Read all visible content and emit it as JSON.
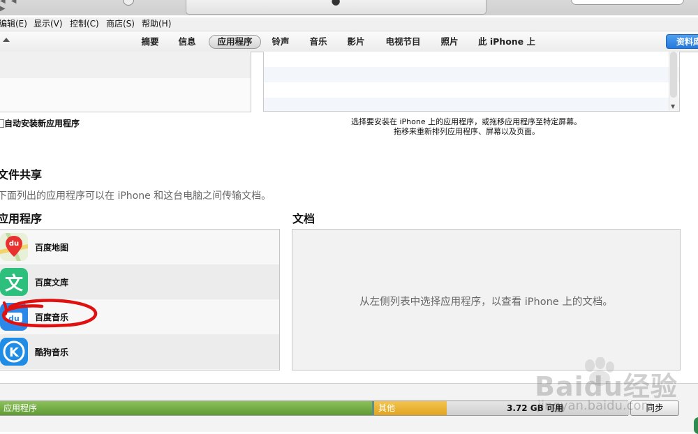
{
  "menubar": {
    "items": [
      "编辑(E)",
      "显示(V)",
      "控制(C)",
      "商店(S)",
      "帮助(H)"
    ]
  },
  "tabs": {
    "items": [
      "摘要",
      "信息",
      "应用程序",
      "铃声",
      "音乐",
      "影片",
      "电视节目",
      "照片",
      "此 iPhone 上"
    ],
    "active": "应用程序",
    "info_button": "资料库"
  },
  "apps_section": {
    "auto_install_label": "自动安装新应用程序",
    "hint_line1": "选择要安装在 iPhone 上的应用程序，或拖移应用程序至特定屏幕。",
    "hint_line2": "拖移来重新排列应用程序、屏幕以及页面。"
  },
  "file_sharing": {
    "title": "文件共享",
    "description": "下面列出的应用程序可以在 iPhone 和这台电脑之间传输文档。",
    "apps_heading": "应用程序",
    "docs_heading": "文档",
    "apps": [
      {
        "name": "百度地图",
        "icon": "baidu-map-icon",
        "badge": "du"
      },
      {
        "name": "百度文库",
        "icon": "baidu-wenku-icon",
        "badge": "文"
      },
      {
        "name": "百度音乐",
        "icon": "baidu-music-icon",
        "badge": "du"
      },
      {
        "name": "酷狗音乐",
        "icon": "kugou-music-icon",
        "badge": "K"
      }
    ],
    "docs_empty_text": "从左侧列表中选择应用程序，以查看 iPhone 上的文档。"
  },
  "capacity": {
    "apps_label": "应用程序",
    "other_label": "其他",
    "free_label": "3.72 GB 可用",
    "apps_color": "#6ea843",
    "other_color": "#edb632",
    "free_color": "#d9d9d9"
  },
  "sync_button": "同步",
  "annotation_color": "#e01010",
  "watermark": {
    "line1": "Baidu经验",
    "line2": "jingyan.baidu.com"
  }
}
